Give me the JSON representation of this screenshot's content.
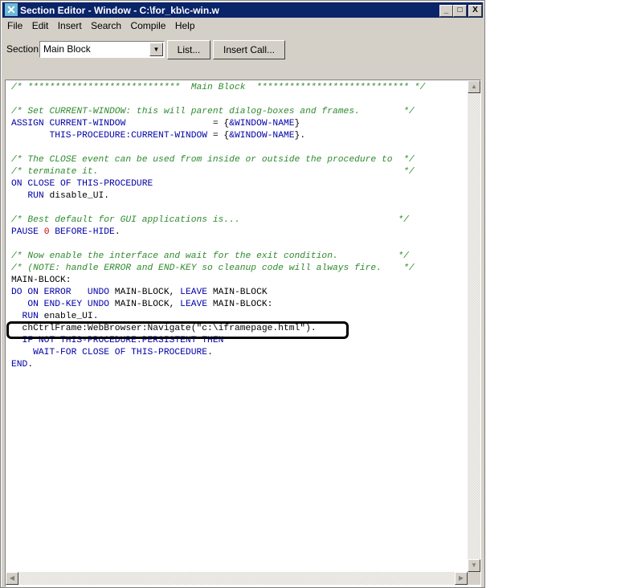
{
  "window": {
    "title": "Section Editor - Window - C:\\for_kb\\c-win.w",
    "minimize": "_",
    "maximize": "□",
    "close": "X"
  },
  "menu": [
    "File",
    "Edit",
    "Insert",
    "Search",
    "Compile",
    "Help"
  ],
  "toolbar": {
    "section_label": "Section:",
    "section_value": "Main Block",
    "list_button": "List...",
    "insert_call_button": "Insert Call..."
  },
  "colors": {
    "comment": "#2e8b2e",
    "keyword": "#0000a8",
    "number": "#d00000",
    "titlebar": "#0a246a"
  },
  "code": [
    [
      [
        "c",
        "/* ****************************  Main Block  **************************** */"
      ]
    ],
    [],
    [
      [
        "c",
        "/* Set CURRENT-WINDOW: this will parent dialog-boxes and frames.        */"
      ]
    ],
    [
      [
        "k",
        "ASSIGN CURRENT-WINDOW"
      ],
      [
        "p",
        "                = {"
      ],
      [
        "k",
        "&WINDOW-NAME"
      ],
      [
        "p",
        "}"
      ]
    ],
    [
      [
        "k",
        "       THIS-PROCEDURE:CURRENT-WINDOW"
      ],
      [
        "p",
        " = {"
      ],
      [
        "k",
        "&WINDOW-NAME"
      ],
      [
        "p",
        "}."
      ]
    ],
    [],
    [
      [
        "c",
        "/* The CLOSE event can be used from inside or outside the procedure to  */"
      ]
    ],
    [
      [
        "c",
        "/* terminate it.                                                        */"
      ]
    ],
    [
      [
        "k",
        "ON CLOSE OF THIS-PROCEDURE"
      ]
    ],
    [
      [
        "k",
        "   RUN"
      ],
      [
        "p",
        " disable_UI."
      ]
    ],
    [],
    [
      [
        "c",
        "/* Best default for GUI applications is...                             */"
      ]
    ],
    [
      [
        "k",
        "PAUSE "
      ],
      [
        "n",
        "0"
      ],
      [
        "k",
        " BEFORE-HIDE"
      ],
      [
        "p",
        "."
      ]
    ],
    [],
    [
      [
        "c",
        "/* Now enable the interface and wait for the exit condition.           */"
      ]
    ],
    [
      [
        "c",
        "/* (NOTE: handle ERROR and END-KEY so cleanup code will always fire.    */"
      ]
    ],
    [
      [
        "p",
        "MAIN-BLOCK:"
      ]
    ],
    [
      [
        "k",
        "DO ON ERROR   UNDO"
      ],
      [
        "p",
        " MAIN-BLOCK, "
      ],
      [
        "k",
        "LEAVE"
      ],
      [
        "p",
        " MAIN-BLOCK"
      ]
    ],
    [
      [
        "k",
        "   ON END-KEY UNDO"
      ],
      [
        "p",
        " MAIN-BLOCK, "
      ],
      [
        "k",
        "LEAVE"
      ],
      [
        "p",
        " MAIN-BLOCK:"
      ]
    ],
    [
      [
        "k",
        "  RUN"
      ],
      [
        "p",
        " enable_UI."
      ]
    ],
    [
      [
        "p",
        "  chCtrlFrame:WebBrowser:Navigate(\"c:\\iframepage.html\")."
      ]
    ],
    [
      [
        "k",
        "  IF NOT THIS-PROCEDURE:PERSISTENT THEN"
      ]
    ],
    [
      [
        "k",
        "    WAIT-FOR CLOSE OF THIS-PROCEDURE"
      ],
      [
        "p",
        "."
      ]
    ],
    [
      [
        "k",
        "END"
      ],
      [
        "p",
        "."
      ]
    ]
  ]
}
